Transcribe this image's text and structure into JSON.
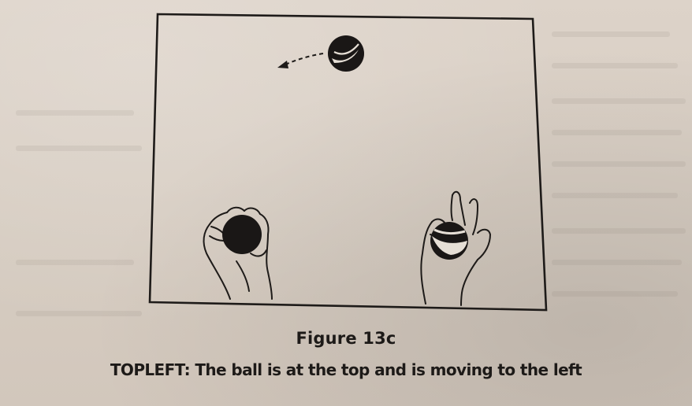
{
  "figure": {
    "title": "Figure 13c",
    "caption": "TOPLEFT: The ball is at the top and is moving to the left"
  }
}
